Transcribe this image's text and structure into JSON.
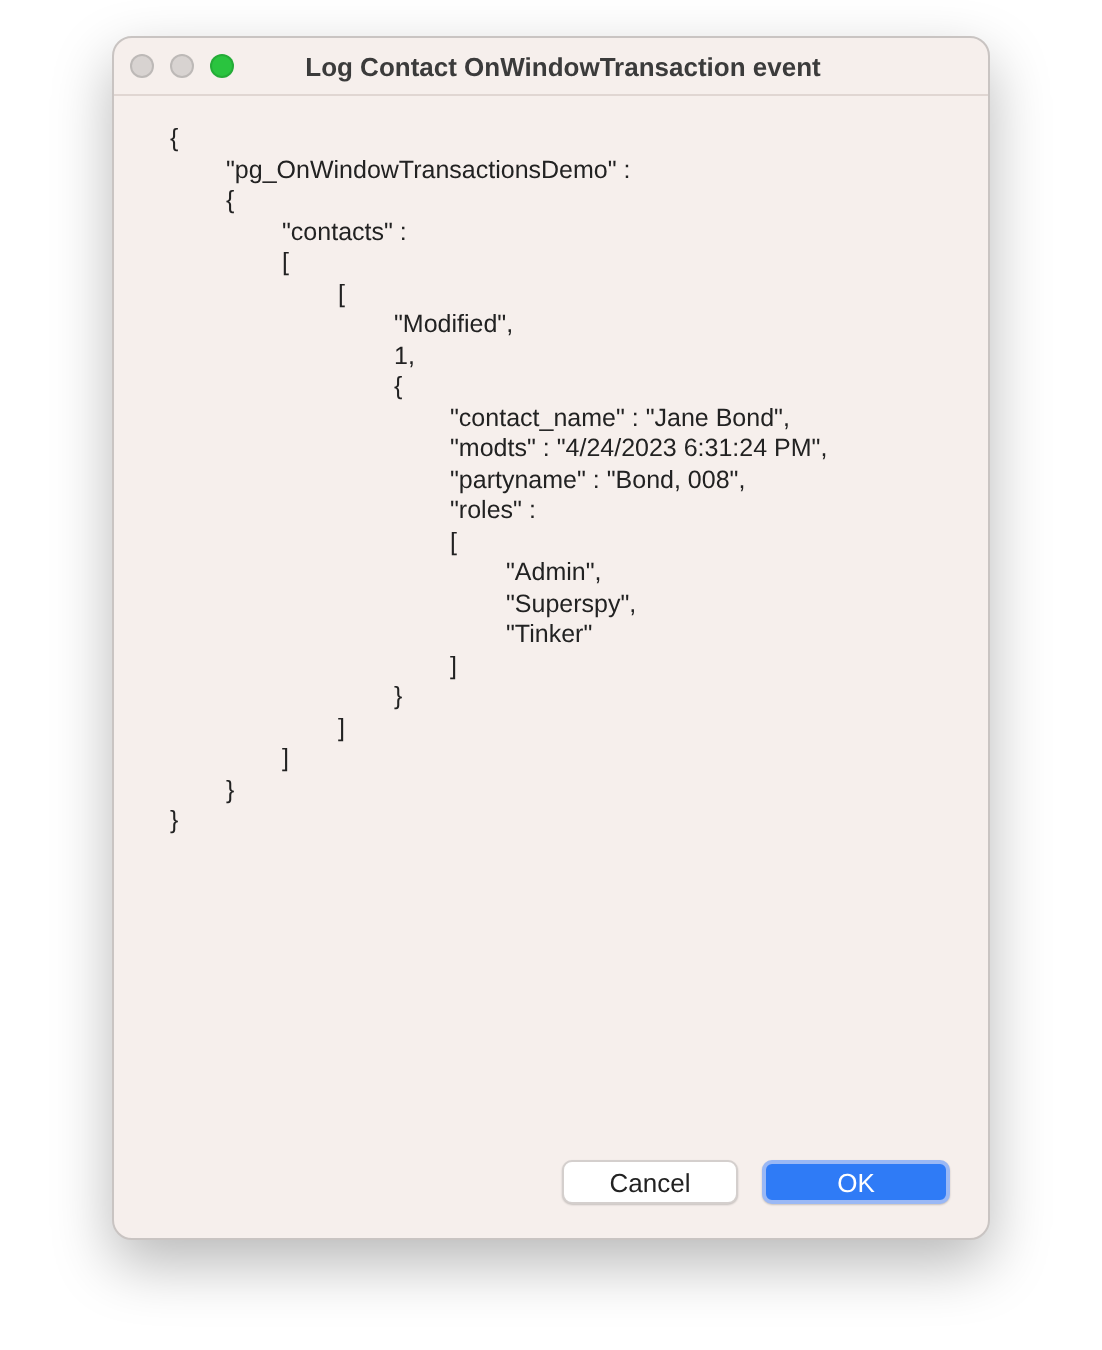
{
  "window": {
    "title": "Log Contact OnWindowTransaction event",
    "buttons": [
      {
        "kind": "close"
      },
      {
        "kind": "minimize"
      },
      {
        "kind": "zoom"
      }
    ]
  },
  "log_lines": [
    {
      "text": "{",
      "children": [
        {
          "text": "\"pg_OnWindowTransactionsDemo\" :"
        },
        {
          "text": "{",
          "children": [
            {
              "text": "\"contacts\" :"
            },
            {
              "text": "[",
              "children": [
                {
                  "text": "[",
                  "children": [
                    {
                      "text": "\"Modified\","
                    },
                    {
                      "text": "1,"
                    },
                    {
                      "text": "{",
                      "children": [
                        {
                          "text": "\"contact_name\" : \"Jane Bond\","
                        },
                        {
                          "text": "\"modts\" : \"4/24/2023 6:31:24 PM\","
                        },
                        {
                          "text": "\"partyname\" : \"Bond, 008\","
                        },
                        {
                          "text": "\"roles\" :"
                        },
                        {
                          "text": "[",
                          "children": [
                            {
                              "text": "\"Admin\","
                            },
                            {
                              "text": "\"Superspy\","
                            },
                            {
                              "text": "\"Tinker\""
                            }
                          ]
                        },
                        {
                          "text": "]"
                        }
                      ]
                    },
                    {
                      "text": "}"
                    }
                  ]
                },
                {
                  "text": "]"
                }
              ]
            },
            {
              "text": "]"
            }
          ]
        },
        {
          "text": "}"
        }
      ]
    },
    {
      "text": "}"
    }
  ],
  "buttons": [
    {
      "label": "Cancel",
      "kind": "secondary"
    },
    {
      "label": "OK",
      "kind": "primary"
    }
  ]
}
